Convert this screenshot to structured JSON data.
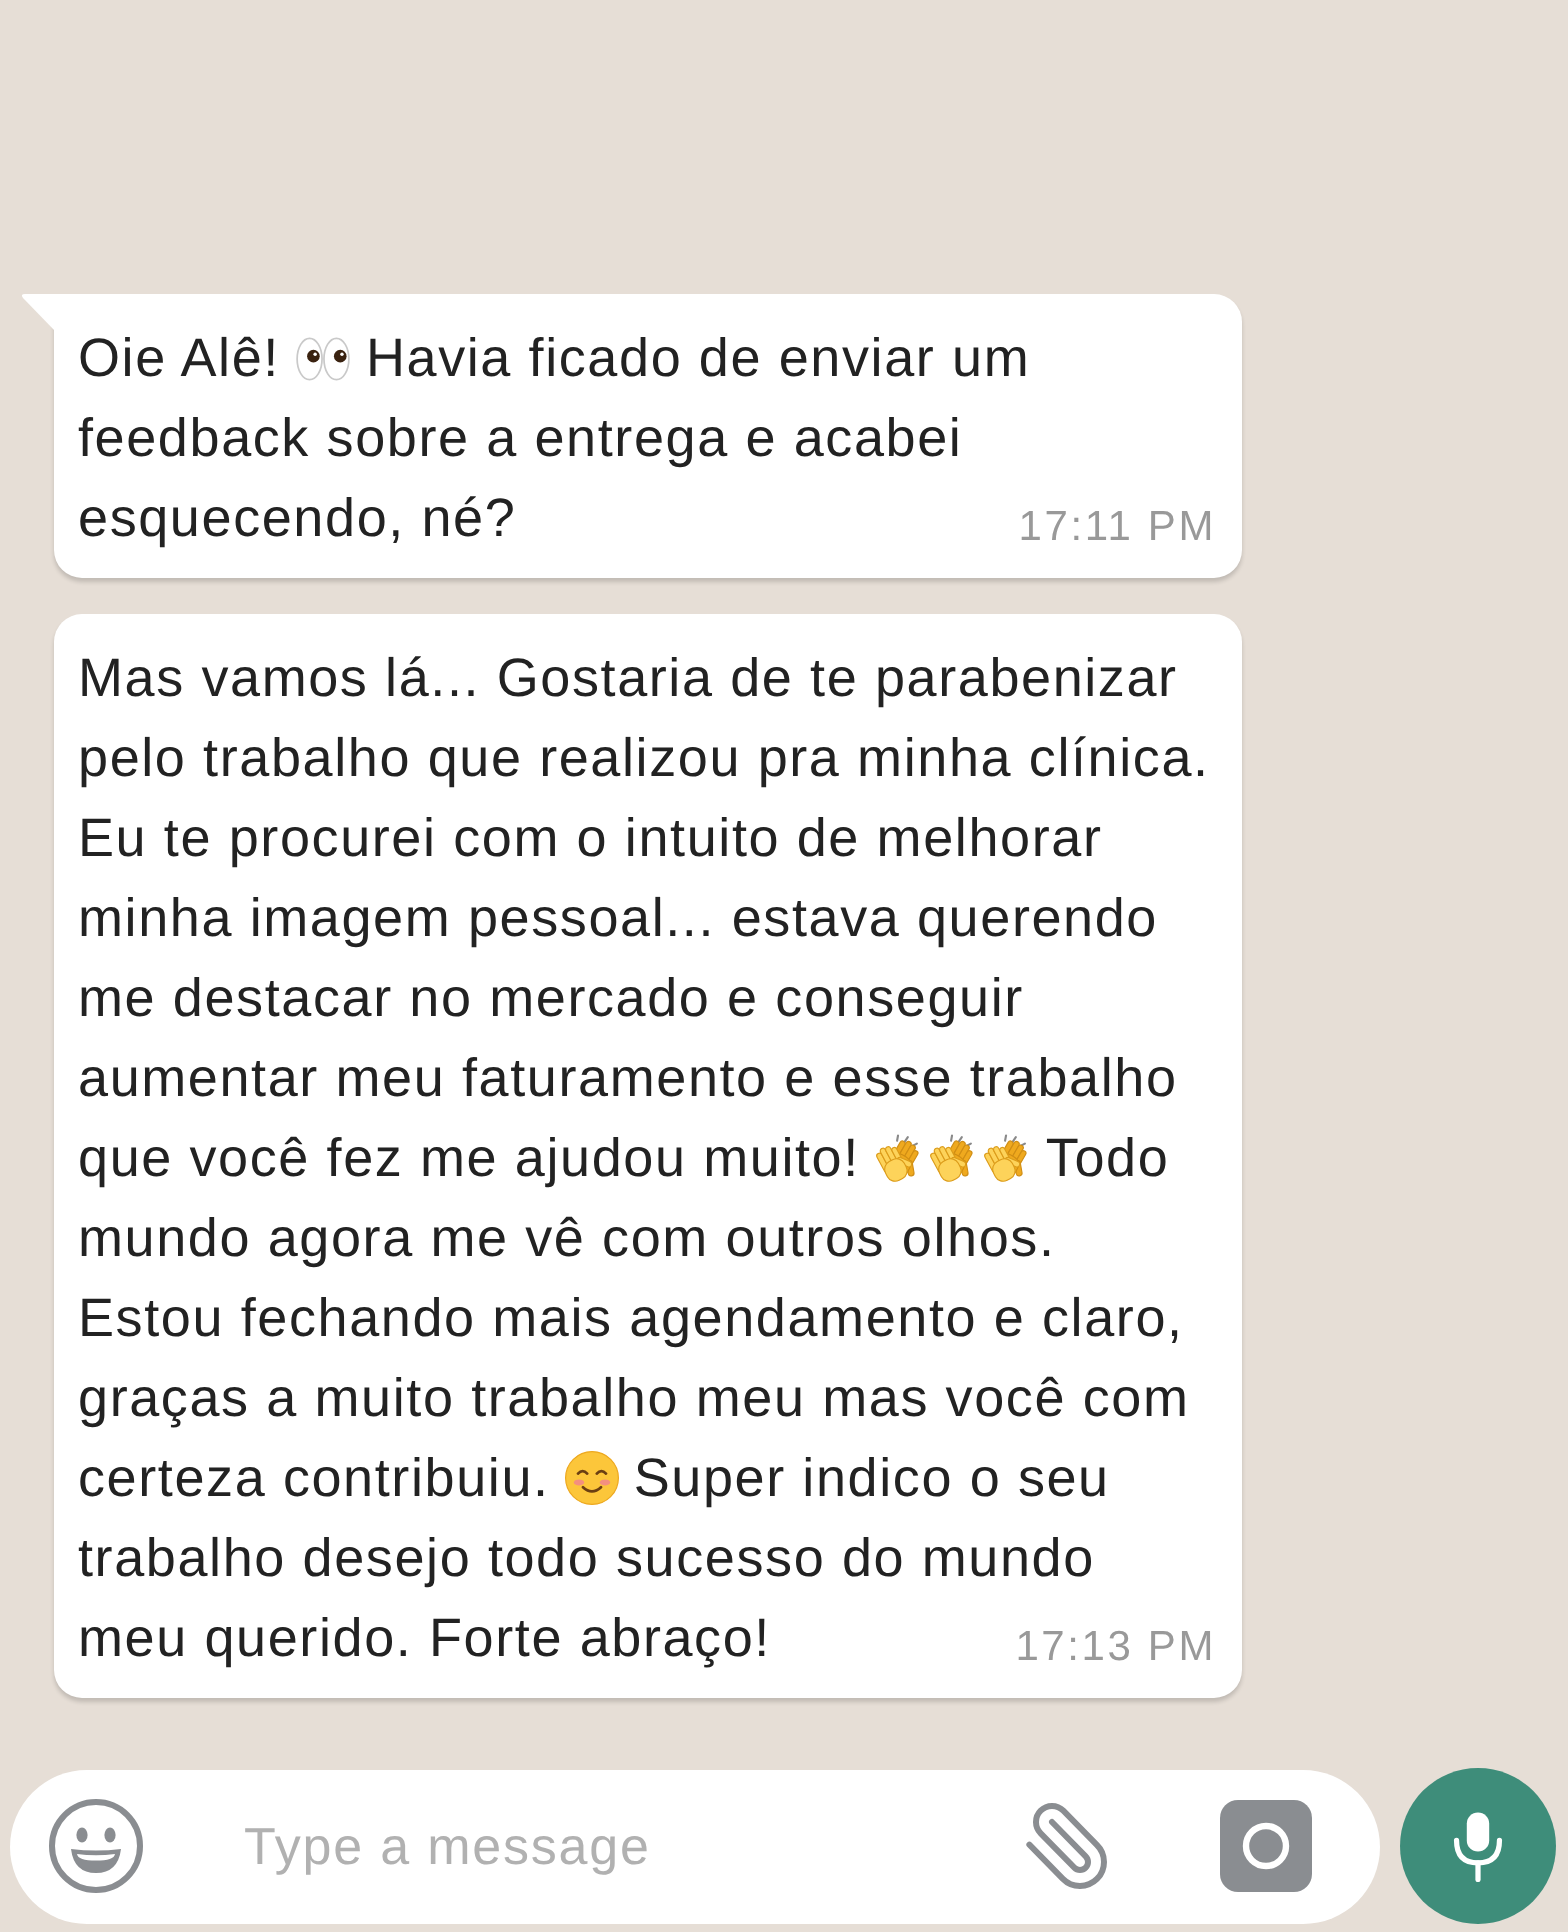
{
  "messages": [
    {
      "tail": true,
      "lines": [
        [
          {
            "kind": "text",
            "text": "Oie Alê!"
          },
          {
            "kind": "eyes"
          },
          {
            "kind": "text",
            "text": "Havia ficado de enviar um"
          }
        ],
        [
          {
            "kind": "text",
            "text": "feedback sobre a entrega e acabei"
          }
        ],
        [
          {
            "kind": "text",
            "text": "esquecendo, né?"
          }
        ]
      ],
      "time": "17:11 PM"
    },
    {
      "tail": false,
      "lines": [
        [
          {
            "kind": "text",
            "text": "Mas vamos lá... Gostaria de te parabenizar"
          }
        ],
        [
          {
            "kind": "text",
            "text": "pelo trabalho que realizou pra minha clínica."
          }
        ],
        [
          {
            "kind": "text",
            "text": "Eu te procurei com o intuito de melhorar"
          }
        ],
        [
          {
            "kind": "text",
            "text": "minha imagem pessoal... estava querendo"
          }
        ],
        [
          {
            "kind": "text",
            "text": "me destacar no mercado e conseguir"
          }
        ],
        [
          {
            "kind": "text",
            "text": "aumentar meu faturamento e esse trabalho"
          }
        ],
        [
          {
            "kind": "text",
            "text": "que você fez me ajudou muito!"
          },
          {
            "kind": "clap"
          },
          {
            "kind": "clap"
          },
          {
            "kind": "clap"
          },
          {
            "kind": "text",
            "text": "Todo"
          }
        ],
        [
          {
            "kind": "text",
            "text": "mundo agora me vê com outros olhos."
          }
        ],
        [
          {
            "kind": "text",
            "text": "Estou fechando mais agendamento e claro,"
          }
        ],
        [
          {
            "kind": "text",
            "text": "graças a muito trabalho meu mas você com"
          }
        ],
        [
          {
            "kind": "text",
            "text": "certeza contribuiu."
          },
          {
            "kind": "smile"
          },
          {
            "kind": "text",
            "text": "Super indico o seu"
          }
        ],
        [
          {
            "kind": "text",
            "text": "trabalho desejo todo sucesso do mundo"
          }
        ],
        [
          {
            "kind": "text",
            "text": "meu querido. Forte abraço!"
          }
        ]
      ],
      "time": "17:13 PM"
    }
  ],
  "composer": {
    "placeholder": "Type a message"
  }
}
